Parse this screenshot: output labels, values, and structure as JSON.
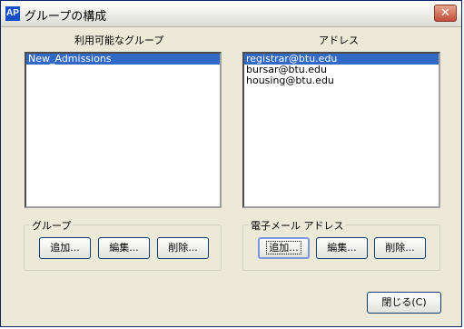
{
  "window": {
    "title": "グループの構成",
    "app_icon_text": "AP",
    "close_glyph": "✕"
  },
  "left": {
    "label": "利用可能なグループ",
    "items": [
      "New_Admissions"
    ],
    "selected_index": 0,
    "group_label": "グループ",
    "buttons": {
      "add": "追加...",
      "edit": "編集...",
      "delete": "削除..."
    }
  },
  "right": {
    "label": "アドレス",
    "items": [
      "registrar@btu.edu",
      "bursar@btu.edu",
      "housing@btu.edu"
    ],
    "selected_index": 0,
    "group_label": "電子メール アドレス",
    "buttons": {
      "add": "追加...",
      "edit": "編集...",
      "delete": "削除..."
    }
  },
  "footer": {
    "close_label": "閉じる(C)"
  },
  "colors": {
    "selection": "#3169c6",
    "dialog_bg": "#ece9d8",
    "app_icon": "#1550c8"
  }
}
